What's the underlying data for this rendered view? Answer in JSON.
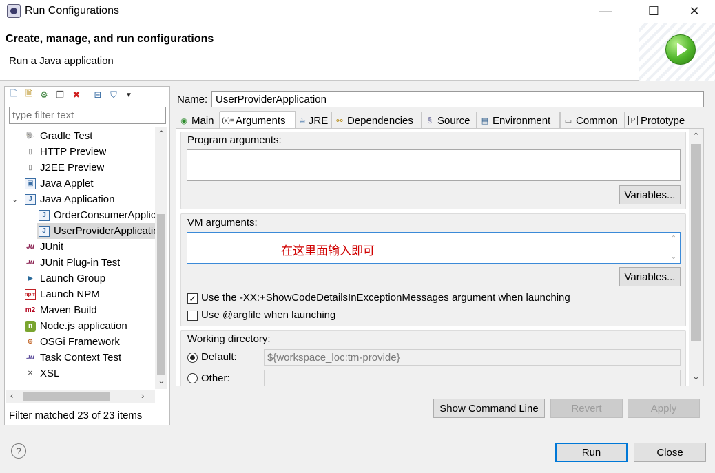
{
  "window": {
    "title": "Run Configurations",
    "minimize": "—",
    "maximize": "☐",
    "close": "✕"
  },
  "header": {
    "title": "Create, manage, and run configurations",
    "subtitle": "Run a Java application",
    "icon": "run-green-icon"
  },
  "left": {
    "toolbar_icons": [
      "new-config-icon",
      "new-prototype-icon",
      "export-icon",
      "duplicate-icon",
      "delete-icon",
      "collapse-all-icon",
      "filter-icon",
      "view-menu-icon"
    ],
    "filter_placeholder": "type filter text",
    "tree": [
      {
        "label": "Gradle Test",
        "icon": "gradle-icon",
        "indent": 0
      },
      {
        "label": "HTTP Preview",
        "icon": "http-icon",
        "indent": 0
      },
      {
        "label": "J2EE Preview",
        "icon": "j2ee-icon",
        "indent": 0
      },
      {
        "label": "Java Applet",
        "icon": "applet-icon",
        "indent": 0
      },
      {
        "label": "Java Application",
        "icon": "java-app-icon",
        "indent": 0,
        "expanded": true
      },
      {
        "label": "OrderConsumerApplication",
        "icon": "java-app-icon",
        "indent": 1
      },
      {
        "label": "UserProviderApplication",
        "icon": "java-app-icon",
        "indent": 1,
        "selected": true
      },
      {
        "label": "JUnit",
        "icon": "junit-icon",
        "indent": 0
      },
      {
        "label": "JUnit Plug-in Test",
        "icon": "junit-plugin-icon",
        "indent": 0
      },
      {
        "label": "Launch Group",
        "icon": "launch-group-icon",
        "indent": 0
      },
      {
        "label": "Launch NPM",
        "icon": "npm-icon",
        "indent": 0
      },
      {
        "label": "Maven Build",
        "icon": "maven-icon",
        "indent": 0
      },
      {
        "label": "Node.js application",
        "icon": "nodejs-icon",
        "indent": 0
      },
      {
        "label": "OSGi Framework",
        "icon": "osgi-icon",
        "indent": 0
      },
      {
        "label": "Task Context Test",
        "icon": "task-context-icon",
        "indent": 0
      },
      {
        "label": "XSL",
        "icon": "xsl-icon",
        "indent": 0
      }
    ],
    "filter_status": "Filter matched 23 of 23 items"
  },
  "right": {
    "name_label": "Name:",
    "name_value": "UserProviderApplication",
    "tabs": [
      {
        "label": "Main",
        "icon": "main-tab-icon"
      },
      {
        "label": "Arguments",
        "icon": "arguments-tab-icon",
        "active": true
      },
      {
        "label": "JRE",
        "icon": "jre-tab-icon"
      },
      {
        "label": "Dependencies",
        "icon": "dependencies-tab-icon"
      },
      {
        "label": "Source",
        "icon": "source-tab-icon"
      },
      {
        "label": "Environment",
        "icon": "environment-tab-icon"
      },
      {
        "label": "Common",
        "icon": "common-tab-icon"
      },
      {
        "label": "Prototype",
        "icon": "prototype-tab-icon"
      }
    ],
    "program_args_label": "Program arguments:",
    "program_args_value": "",
    "variables_label": "Variables...",
    "vm_args_label": "VM arguments:",
    "vm_args_hint": "在这里面输入即可",
    "checkbox1_label": "Use the -XX:+ShowCodeDetailsInExceptionMessages argument when launching",
    "checkbox1_checked": true,
    "checkbox2_label": "Use @argfile when launching",
    "checkbox2_checked": false,
    "working_dir_label": "Working directory:",
    "default_label": "Default:",
    "default_value": "${workspace_loc:tm-provide}",
    "other_label": "Other:",
    "other_value": ""
  },
  "buttons": {
    "show_command_line": "Show Command Line",
    "revert": "Revert",
    "apply": "Apply",
    "run": "Run",
    "close": "Close"
  },
  "colors": {
    "hint_text": "#d00000",
    "focus_border": "#3b8ad8",
    "default_button_border": "#0078d7"
  }
}
